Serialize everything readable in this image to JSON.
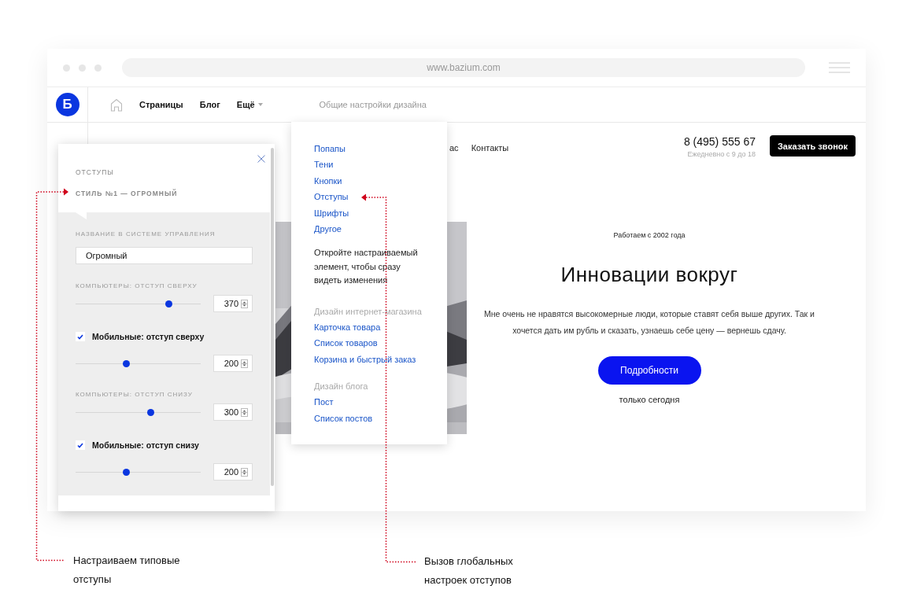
{
  "browser": {
    "url": "www.bazium.com"
  },
  "topbar": {
    "logo": "Б",
    "nav": [
      {
        "kind": "home"
      },
      {
        "kind": "link",
        "label": "Страницы"
      },
      {
        "kind": "link",
        "label": "Блог"
      },
      {
        "kind": "menu",
        "label": "Ещё"
      }
    ],
    "settings_label": "Общие настройки дизайна"
  },
  "site_header": {
    "nav": [
      "ас",
      "Контакты"
    ],
    "phone": "8 (495) 555 67",
    "hours": "Ежедневно с 9 до 18",
    "call_button": "Заказать звонок"
  },
  "hero": {
    "kicker": "Работаем с 2002 года",
    "title": "Инновации вокруг",
    "text": "Мне очень не нравятся высокомерные люди, которые ставят себя выше других. Так и хочется дать им рубль и сказать, узнаешь себе цену — вернешь сдачу.",
    "button": "Подробности",
    "note": "только сегодня"
  },
  "design_menu": {
    "entries": [
      {
        "kind": "link",
        "text": "Попапы"
      },
      {
        "kind": "link",
        "text": "Тени"
      },
      {
        "kind": "link",
        "text": "Кнопки"
      },
      {
        "kind": "link",
        "text": "Отступы"
      },
      {
        "kind": "link",
        "text": "Шрифты"
      },
      {
        "kind": "link",
        "text": "Другое"
      },
      {
        "kind": "hint",
        "text": "Откройте настраиваемый элемент, чтобы сразу видеть изменения"
      },
      {
        "kind": "heading",
        "text": "Дизайн интернет-магазина"
      },
      {
        "kind": "link",
        "text": "Карточка товара"
      },
      {
        "kind": "link",
        "text": "Список товаров"
      },
      {
        "kind": "link",
        "text": "Корзина и быстрый заказ"
      },
      {
        "kind": "heading",
        "text": "Дизайн блога"
      },
      {
        "kind": "link",
        "text": "Пост"
      },
      {
        "kind": "link",
        "text": "Список постов"
      }
    ]
  },
  "spacing_panel": {
    "section": "ОТСТУПЫ",
    "style_title": "СТИЛЬ №1 — ОГРОМНЫЙ",
    "rows": [
      {
        "kind": "label",
        "text": "НАЗВАНИЕ В СИСТЕМЕ УПРАВЛЕНИЯ"
      },
      {
        "kind": "text_field",
        "value": "Огромный"
      },
      {
        "kind": "label",
        "text": "КОМПЬЮТЕРЫ: ОТСТУП СВЕРХУ"
      },
      {
        "kind": "slider",
        "level": 0.74,
        "value": "370"
      },
      {
        "kind": "checkbox",
        "label": "Мобильные: отступ сверху",
        "checked": true
      },
      {
        "kind": "slider",
        "level": 0.4,
        "value": "200"
      },
      {
        "kind": "label",
        "text": "КОМПЬЮТЕРЫ: ОТСТУП СНИЗУ"
      },
      {
        "kind": "slider",
        "level": 0.6,
        "value": "300"
      },
      {
        "kind": "checkbox",
        "label": "Мобильные: отступ снизу",
        "checked": true
      },
      {
        "kind": "slider",
        "level": 0.4,
        "value": "200"
      }
    ]
  },
  "annotations": [
    {
      "text": "Настраиваем типовые отступы"
    },
    {
      "text": "Вызов глобальных настроек отступов"
    }
  ]
}
